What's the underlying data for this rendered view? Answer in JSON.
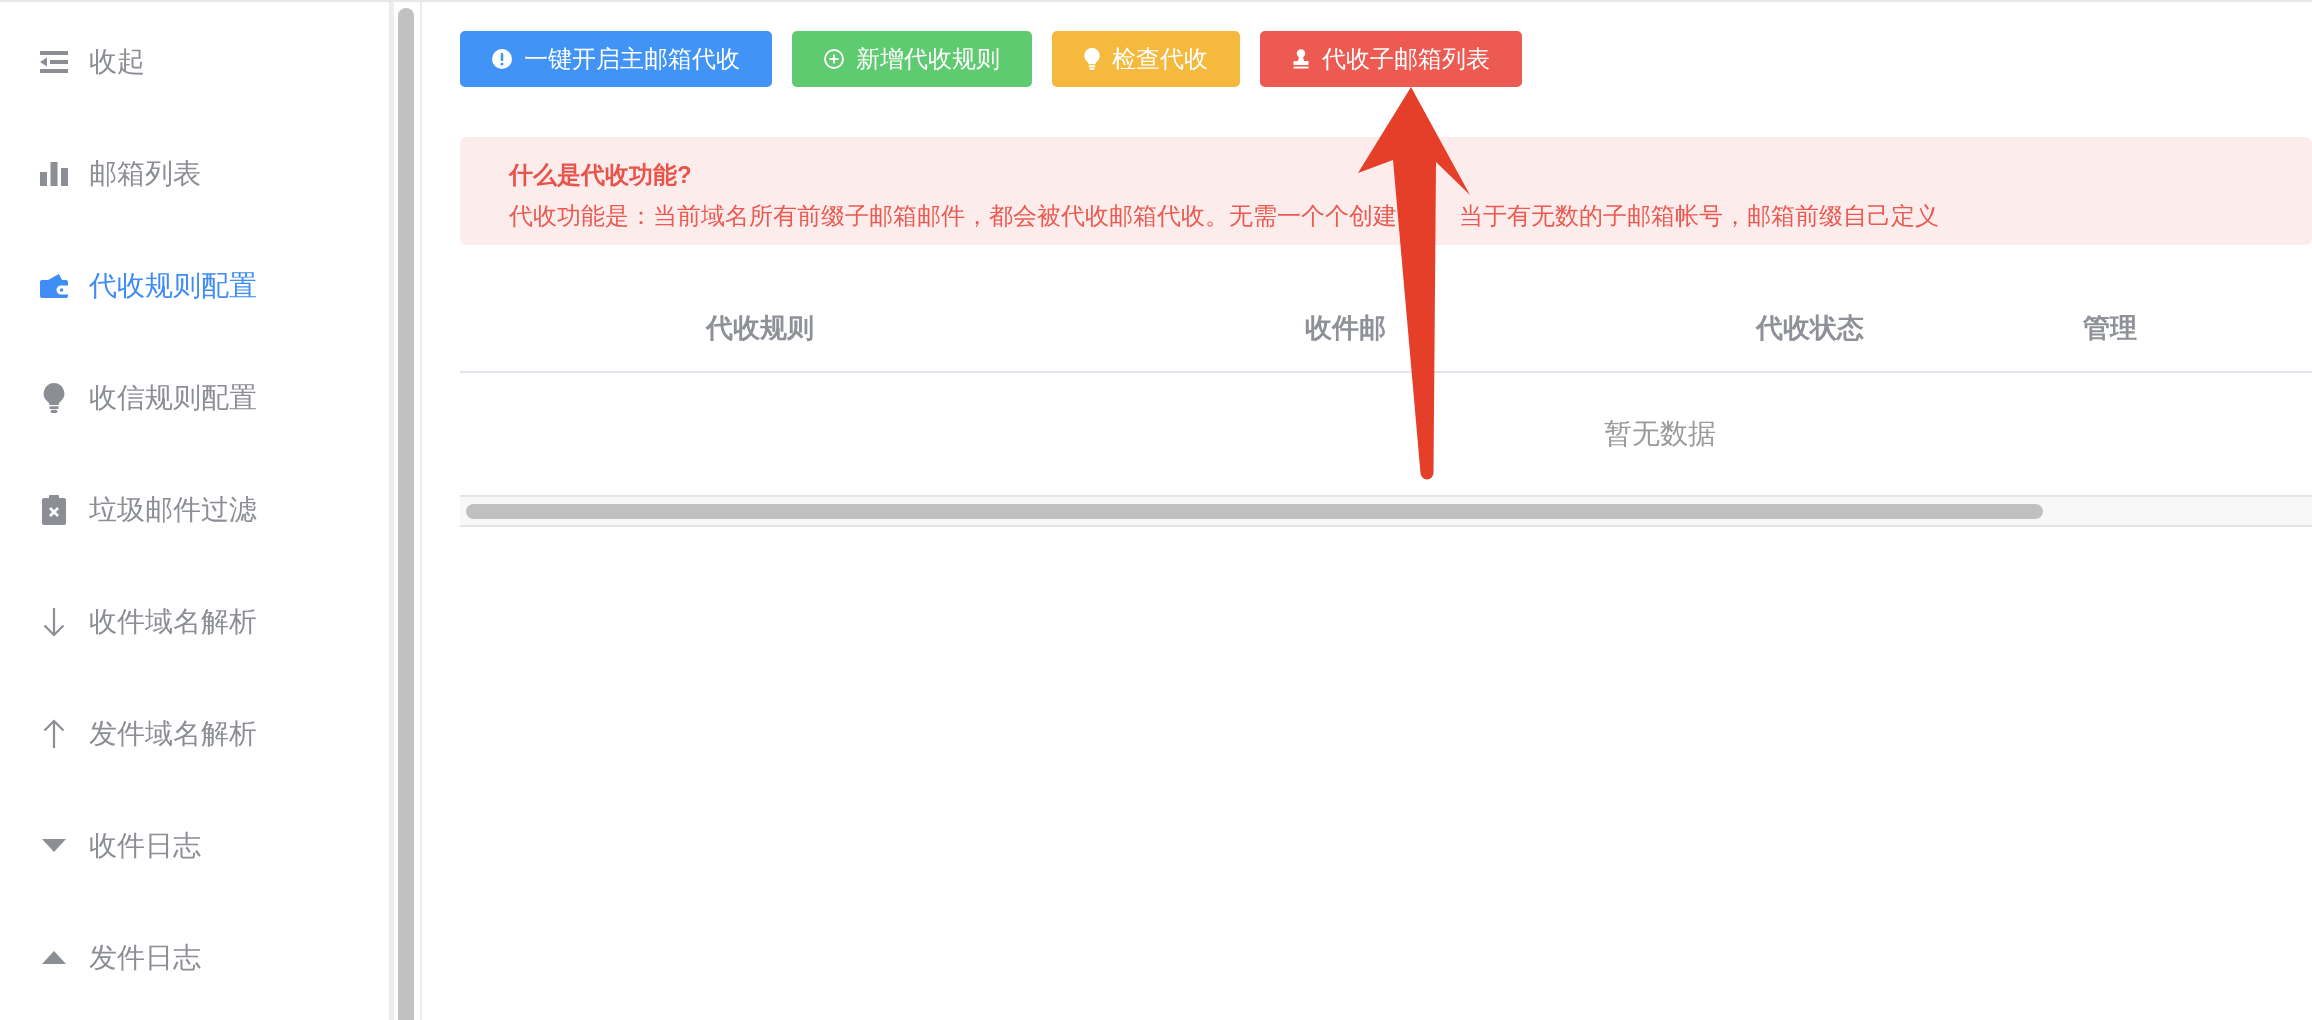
{
  "sidebar": {
    "items": [
      {
        "label": "收起",
        "selected": false
      },
      {
        "label": "邮箱列表",
        "selected": false
      },
      {
        "label": "代收规则配置",
        "selected": true
      },
      {
        "label": "收信规则配置",
        "selected": false
      },
      {
        "label": "垃圾邮件过滤",
        "selected": false
      },
      {
        "label": "收件域名解析",
        "selected": false
      },
      {
        "label": "发件域名解析",
        "selected": false
      },
      {
        "label": "收件日志",
        "selected": false
      },
      {
        "label": "发件日志",
        "selected": false
      }
    ]
  },
  "toolbar": {
    "buttons": [
      {
        "label": "一键开启主邮箱代收",
        "color": "#4194f6"
      },
      {
        "label": "新增代收规则",
        "color": "#5fcb71"
      },
      {
        "label": "检查代收",
        "color": "#f5b93e"
      },
      {
        "label": "代收子邮箱列表",
        "color": "#ec5a52"
      }
    ]
  },
  "notice": {
    "title": "什么是代收功能?",
    "text_parts": [
      "代收功能是：当前域名所有前缀子邮箱邮件，都会被代收邮箱代收。无需一个个创建",
      "当于有无数的子邮箱帐号，邮箱前缀自己定义"
    ]
  },
  "table": {
    "columns": [
      "代收规则",
      "收件邮",
      "代收状态",
      "管理"
    ],
    "empty_text": "暂无数据"
  }
}
